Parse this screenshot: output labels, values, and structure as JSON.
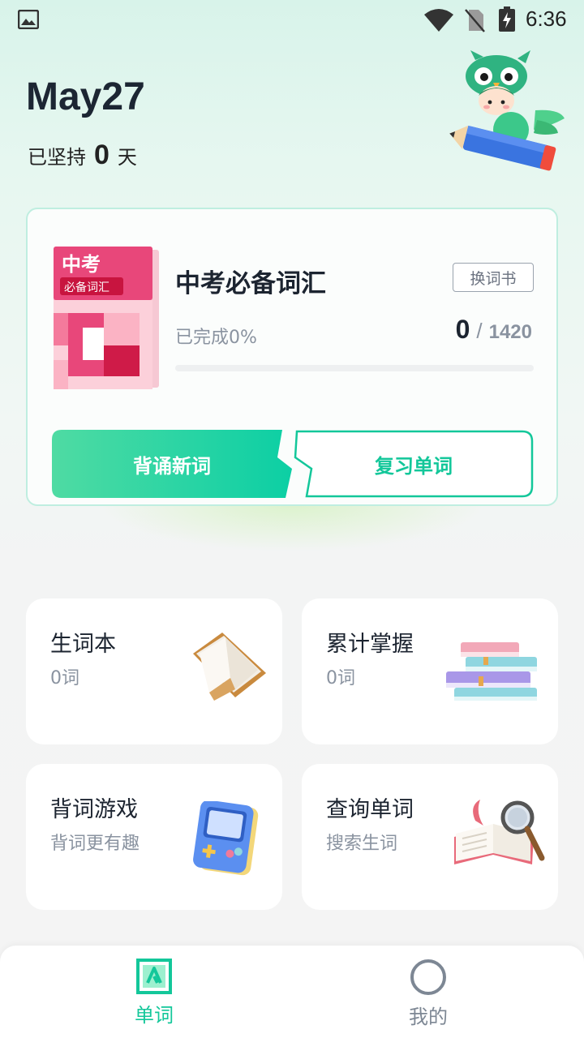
{
  "status_bar": {
    "time": "6:36",
    "icons": [
      "photo-icon",
      "wifi-icon",
      "no-sim-icon",
      "battery-charging-icon"
    ]
  },
  "header": {
    "date": "May27",
    "streak_prefix": "已坚持",
    "streak_days": "0",
    "streak_suffix": "天"
  },
  "book": {
    "cover_title": "中考",
    "cover_subtitle": "必备词汇",
    "title": "中考必备词汇",
    "change_label": "换词书",
    "completed_label": "已完成0%",
    "learned": "0",
    "separator": "/",
    "total": "1420",
    "progress": 0,
    "learn_label": "背诵新词",
    "review_label": "复习单词"
  },
  "tiles": [
    {
      "title": "生词本",
      "subtitle": "0词",
      "icon": "open-book-icon"
    },
    {
      "title": "累计掌握",
      "subtitle": "0词",
      "icon": "book-stack-icon"
    },
    {
      "title": "背词游戏",
      "subtitle": "背词更有趣",
      "icon": "game-console-icon"
    },
    {
      "title": "查询单词",
      "subtitle": "搜索生词",
      "icon": "magnifier-book-icon"
    }
  ],
  "nav": {
    "items": [
      {
        "label": "单词",
        "icon": "word-tab-icon",
        "active": true
      },
      {
        "label": "我的",
        "icon": "profile-tab-icon",
        "active": false
      }
    ]
  },
  "colors": {
    "accent": "#13c79a",
    "text_dark": "#1c2430",
    "text_muted": "#8a93a0",
    "cover_pink": "#e8477a"
  }
}
